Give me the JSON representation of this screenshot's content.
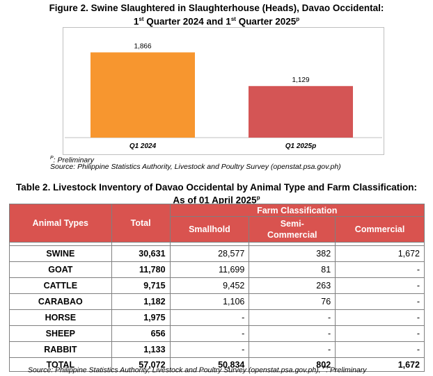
{
  "figure": {
    "title_line1": "Figure 2. Swine Slaughtered in Slaughterhouse (Heads), Davao Occidental:",
    "title_line2_a": "1",
    "title_line2_a_sup": "st",
    "title_line2_b": " Quarter 2024 and 1",
    "title_line2_b_sup": "st",
    "title_line2_c": " Quarter 2025",
    "title_line2_c_sup": "p",
    "preliminary_sup": "P",
    "preliminary_note": ": Preliminary",
    "source": "Source: Philippine Statistics Authority, Livestock and Poultry Survey (openstat.psa.gov.ph)"
  },
  "chart_data": {
    "type": "bar",
    "categories": [
      "Q1 2024",
      "Q1 2025p"
    ],
    "values": [
      1866,
      1129
    ],
    "value_labels": [
      "1,866",
      "1,129"
    ],
    "colors": [
      "#f7962f",
      "#d45555"
    ],
    "ylim": [
      0,
      2100
    ],
    "grid": false,
    "legend": "none"
  },
  "table": {
    "title_line1": "Table 2. Livestock Inventory of Davao Occidental by Animal Type and Farm Classification:",
    "title_line2": "As of 01 April 2025",
    "title_line2_sup": "p",
    "headers": {
      "animal_types": "Animal Types",
      "total": "Total",
      "farm_classification": "Farm Classification",
      "smallhold": "Smallhold",
      "semi_commercial_1": "Semi-",
      "semi_commercial_2": "Commercial",
      "commercial": "Commercial"
    },
    "rows": [
      {
        "name": "SWINE",
        "total": "30,631",
        "smallhold": "28,577",
        "semi": "382",
        "commercial": "1,672"
      },
      {
        "name": "GOAT",
        "total": "11,780",
        "smallhold": "11,699",
        "semi": "81",
        "commercial": "-"
      },
      {
        "name": "CATTLE",
        "total": "9,715",
        "smallhold": "9,452",
        "semi": "263",
        "commercial": "-"
      },
      {
        "name": "CARABAO",
        "total": "1,182",
        "smallhold": "1,106",
        "semi": "76",
        "commercial": "-"
      },
      {
        "name": "HORSE",
        "total": "1,975",
        "smallhold": "-",
        "semi": "-",
        "commercial": "-"
      },
      {
        "name": "SHEEP",
        "total": "656",
        "smallhold": "-",
        "semi": "-",
        "commercial": "-"
      },
      {
        "name": "RABBIT",
        "total": "1,133",
        "smallhold": "-",
        "semi": "-",
        "commercial": "-"
      }
    ],
    "total_row": {
      "name": "TOTAL",
      "total": "57,072",
      "smallhold": "50,834",
      "semi": "802",
      "commercial": "1,672"
    },
    "source": "Source: Philippine Statistics Authority, Livestock and Poultry Survey (openstat.psa.gov.ph), ",
    "source_sup": "P",
    "source_tail": ": Preliminary"
  }
}
